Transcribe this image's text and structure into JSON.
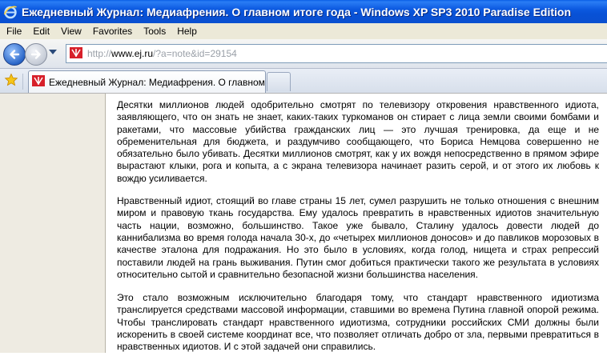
{
  "window": {
    "title": "Ежедневный Журнал: Медиафрения. О главном итоге года - Windows XP SP3 2010 Paradise Edition"
  },
  "menu": [
    "File",
    "Edit",
    "View",
    "Favorites",
    "Tools",
    "Help"
  ],
  "address": {
    "scheme": "http://",
    "host": "www.ej.ru",
    "path": "/?a=note&id=29154"
  },
  "tabs": [
    {
      "title": "Ежедневный Журнал: Медиафрения. О главном и..."
    }
  ],
  "icons": {
    "browser": "internet-explorer-icon",
    "back": "back-arrow-icon",
    "forward": "forward-arrow-icon",
    "site": "ej-favicon",
    "favorites": "star-icon"
  },
  "colors": {
    "titlebar": "#0a55dc",
    "menubar": "#ece9d8",
    "sidebar": "#eeebe2",
    "favicon": "#d7202a"
  },
  "article": {
    "paragraphs": [
      "Десятки миллионов людей одобрительно смотрят по телевизору откровения нравственного идиота, заявляющего, что он знать не знает, каких-таких туркоманов он стирает с лица земли своими бомбами и ракетами, что массовые убийства гражданских лиц — это лучшая тренировка, да еще и не обременительная для бюджета, и раздумчиво сообщающего, что Бориса Немцова совершенно не обязательно было убивать. Десятки миллионов смотрят, как у их вождя непосредственно в прямом эфире вырастают клыки, рога и копыта, а с экрана телевизора начинает разить серой, и от этого их любовь к вождю усиливается.",
      "Нравственный идиот, стоящий во главе страны 15 лет, сумел разрушить не только отношения с внешним миром и правовую ткань государства. Ему удалось превратить в нравственных идиотов значительную часть нации, возможно, большинство. Такое уже бывало, Сталину удалось довести людей до каннибализма во время голода начала 30-х, до «четырех миллионов доносов» и до павликов морозовых в качестве эталона для подражания. Но это было в условиях, когда голод, нищета и страх репрессий поставили людей на грань выживания. Путин смог добиться практически такого же результата в условиях относительно сытой и сравнительно безопасной жизни большинства населения.",
      "Это стало возможным исключительно благодаря тому, что стандарт нравственного идиотизма транслируется средствами массовой информации, ставшими во времена Путина главной опорой режима. Чтобы транслировать стандарт нравственного идиотизма, сотрудники российских СМИ должны были искоренить в своей системе координат все, что позволяет отличать добро от зла, первыми превратиться в нравственных идиотов. И с этой задачей они справились."
    ]
  }
}
